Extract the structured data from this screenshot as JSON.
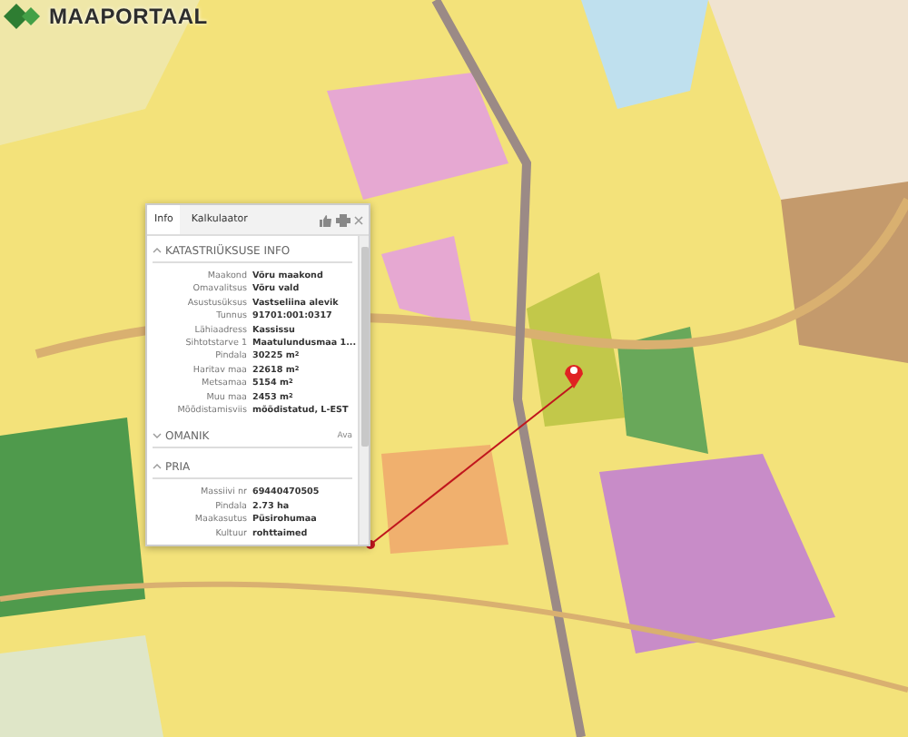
{
  "logo": {
    "text": "MAAPORTAAL"
  },
  "popup": {
    "tabs": [
      {
        "label": "Info",
        "selected": true
      },
      {
        "label": "Kalkulaator",
        "selected": false
      }
    ],
    "sections": [
      {
        "title": "KATASTRIÜKSUSE INFO",
        "expanded": true,
        "rows": [
          {
            "label": "Maakond",
            "value": "Võru maakond"
          },
          {
            "label": "Omavalitsus",
            "value": "Võru vald"
          },
          {
            "label": "Asustusüksus",
            "value": "Vastseliina alevik"
          },
          {
            "label": "Tunnus",
            "value": "91701:001:0317"
          },
          {
            "label": "Lähiaadress",
            "value": "Kassissu"
          },
          {
            "label": "Sihtotstarve 1",
            "value": "Maatulundusmaa 1..."
          },
          {
            "label": "Pindala",
            "value": "30225 m$^{2}$"
          },
          {
            "label": "Haritav maa",
            "value": "22618 m$^{2}$"
          },
          {
            "label": "Metsamaa",
            "value": "5154 m$^{2}$"
          },
          {
            "label": "Muu maa",
            "value": "2453 m$^{2}$"
          },
          {
            "label": "Mõõdistamisviis",
            "value": "mõõdistatud, L-EST"
          }
        ]
      },
      {
        "title": "OMANIK",
        "expanded": false,
        "action": "Ava"
      },
      {
        "title": "PRIA",
        "expanded": true,
        "rows": [
          {
            "label": "Massiivi nr",
            "value": "69440470505"
          },
          {
            "label": "Pindala",
            "value": "2.73 ha"
          },
          {
            "label": "Maakasutus",
            "value": "Püsirohumaa"
          },
          {
            "label": "Kultuur",
            "value": "rohttaimed"
          }
        ]
      }
    ]
  }
}
